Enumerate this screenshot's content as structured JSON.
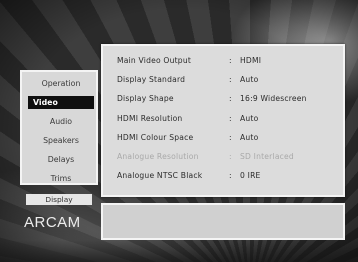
{
  "menu": {
    "items": [
      {
        "label": "Operation",
        "selected": false
      },
      {
        "label": "Video",
        "selected": true
      },
      {
        "label": "Audio",
        "selected": false
      },
      {
        "label": "Speakers",
        "selected": false
      },
      {
        "label": "Delays",
        "selected": false
      },
      {
        "label": "Trims",
        "selected": false
      }
    ],
    "display_tab": "Display"
  },
  "settings": {
    "separator": ":",
    "rows": [
      {
        "label": "Main Video Output",
        "value": "HDMI",
        "enabled": true
      },
      {
        "label": "Display Standard",
        "value": "Auto",
        "enabled": true
      },
      {
        "label": "Display Shape",
        "value": "16:9 Widescreen",
        "enabled": true
      },
      {
        "label": "HDMI Resolution",
        "value": "Auto",
        "enabled": true
      },
      {
        "label": "HDMI Colour Space",
        "value": "Auto",
        "enabled": true
      },
      {
        "label": "Analogue Resolution",
        "value": "SD Interlaced",
        "enabled": false
      },
      {
        "label": "Analogue NTSC Black",
        "value": "0 IRE",
        "enabled": true
      }
    ]
  },
  "info_panel": {
    "text": ""
  },
  "logo": {
    "text": "ARCAM"
  }
}
